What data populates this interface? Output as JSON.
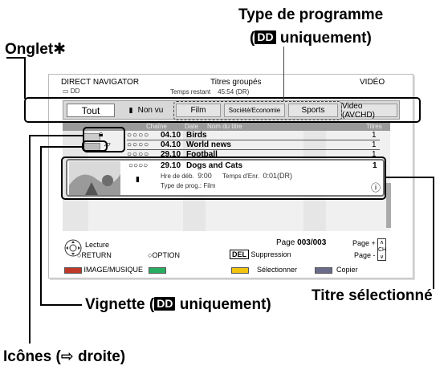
{
  "callouts": {
    "program_type_line1": "Type de programme",
    "program_type_paren_open": "(",
    "program_type_dd": "DD",
    "program_type_suffix": " uniquement)",
    "tab_label": "Onglet✱",
    "thumbnail_prefix": "Vignette (",
    "thumbnail_dd": "DD",
    "thumbnail_suffix": " uniquement)",
    "selected_title": "Titre sélectionné",
    "icons": "Icônes (⇨ droite)"
  },
  "screen": {
    "app_title": "DIRECT NAVIGATOR",
    "view_title": "Titres groupés",
    "media": "VIDÉO",
    "drive": "DD",
    "remaining_label": "Temps restant",
    "remaining_value": "45:54 (DR)",
    "tabs": [
      {
        "label": "Tout",
        "active": true
      },
      {
        "label": "Non vu",
        "active": false
      },
      {
        "label": "Film",
        "active": false
      },
      {
        "label": "Société/Economie",
        "active": false
      },
      {
        "label": "Sports",
        "active": false
      },
      {
        "label": "Video (AVCHD)",
        "active": false
      }
    ],
    "columns": {
      "channel": "Chaîne",
      "date": "Date",
      "name": "Nom du titre",
      "titles": "Titres"
    },
    "rows": [
      {
        "circles": "○○○○",
        "date": "04.10",
        "name": "Birds",
        "count": "1"
      },
      {
        "circles": "○○○○",
        "date": "04.10",
        "name": "World news",
        "count": "1"
      },
      {
        "circles": "○○○○",
        "date": "29.10",
        "name": "Football",
        "count": "1"
      }
    ],
    "selected": {
      "circles": "○○○○",
      "date": "29.10",
      "name": "Dogs and Cats",
      "count": "1",
      "start_label": "Hre de déb.",
      "start_value": "9:00",
      "rec_label": "Temps d'Enr.",
      "rec_value": "0:01(DR)",
      "type_label": "Type de prog.:",
      "type_value": "Film",
      "info_icon": "ⓘ"
    },
    "footer": {
      "play": "Lecture",
      "return": "RETURN",
      "option": "OPTION",
      "page_label": "Page",
      "page_value": "003/003",
      "page_plus": "Page +",
      "page_minus": "Page -",
      "ch": "CH",
      "del_key": "DEL",
      "delete": "Suppression",
      "image_music": "IMAGE/MUSIQUE",
      "select": "Sélectionner",
      "copy": "Copier"
    },
    "colors": {
      "red": "#c0392b",
      "green": "#27ae60",
      "yellow": "#f1c40f",
      "blue": "#6b6b8a"
    }
  }
}
